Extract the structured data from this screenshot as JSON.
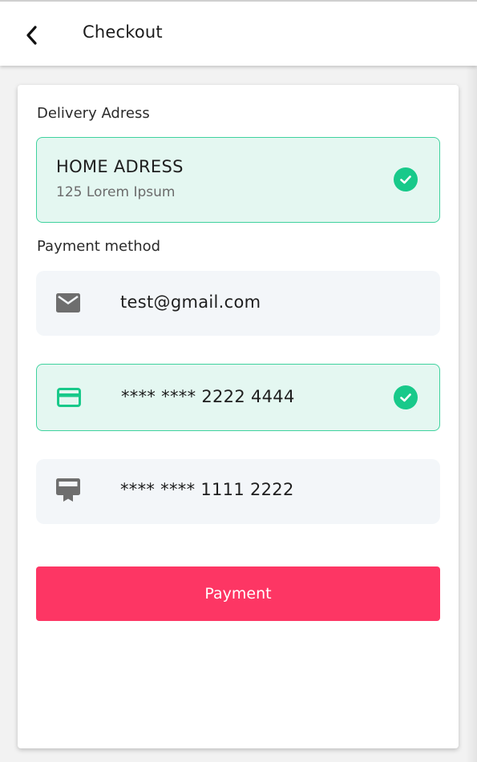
{
  "header": {
    "title": "Checkout",
    "back_icon": "chevron-left-icon"
  },
  "delivery": {
    "label": "Delivery Adress",
    "address": {
      "title": "HOME ADRESS",
      "line": "125 Lorem Ipsum",
      "selected": true
    }
  },
  "payment": {
    "label": "Payment method",
    "methods": [
      {
        "icon": "mail-icon",
        "text": "test@gmail.com",
        "selected": false
      },
      {
        "icon": "credit-card-icon",
        "text": "**** **** 2222 4444",
        "selected": true
      },
      {
        "icon": "card-ribbon-icon",
        "text": "**** **** 1111 2222",
        "selected": false
      }
    ],
    "button_label": "Payment"
  },
  "colors": {
    "accent_green": "#18c98a",
    "selected_bg": "#e4f7f1",
    "row_bg": "#f3f6f9",
    "button_pink": "#fd3664"
  }
}
